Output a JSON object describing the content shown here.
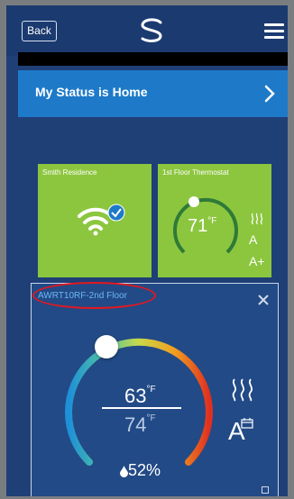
{
  "header": {
    "back_label": "Back",
    "logo_icon": "swirl-logo-icon",
    "menu_icon": "hamburger-menu-icon"
  },
  "status": {
    "label": "My Status is Home",
    "chevron_icon": "chevron-right-icon"
  },
  "tiles": [
    {
      "title": "Smith Residence",
      "icons": [
        "wifi-icon",
        "check-badge-icon"
      ]
    },
    {
      "title": "1st Floor Thermostat",
      "temperature": "71",
      "unit": "°F",
      "mode_label": "A",
      "auto_label": "A+"
    }
  ],
  "detail": {
    "title": "AWRT10RF-2nd Floor",
    "setpoint": "63",
    "setpoint_unit": "°F",
    "current": "74",
    "current_unit": "°F",
    "humidity": "52%",
    "mode_label": "A",
    "close_icon": "close-icon",
    "heat_icon": "heat-icon"
  },
  "colors": {
    "background": "#1f3f77",
    "status_blue": "#1e7ac8",
    "tile_green": "#8cc63f",
    "highlight_red": "#e3181f",
    "title_blue": "#6db7f2"
  }
}
